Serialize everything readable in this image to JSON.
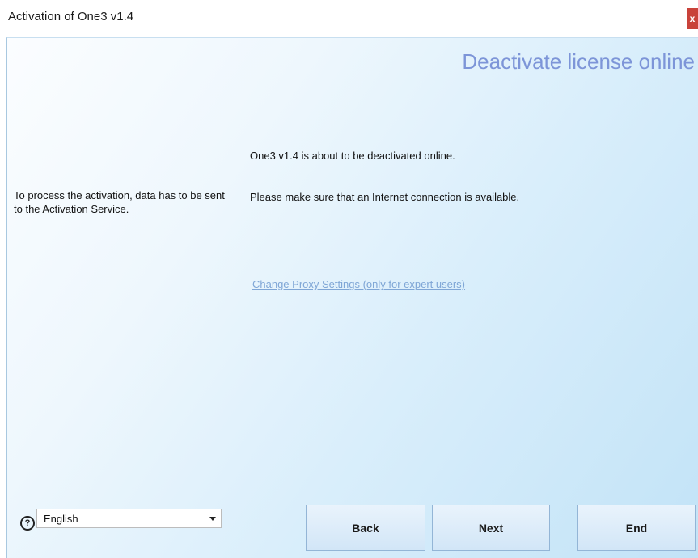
{
  "window": {
    "title": "Activation of One3 v1.4",
    "close_glyph": "x"
  },
  "page": {
    "heading": "Deactivate license online",
    "left_info": "To process the activation, data has to be sent to the Activation Service.",
    "message_1": "One3 v1.4 is about to be deactivated online.",
    "message_2": "Please make sure that an Internet connection is available.",
    "proxy_link": "Change Proxy Settings (only for expert users)"
  },
  "footer": {
    "help_glyph": "?",
    "help_icon": "question-circle-icon",
    "language_selected": "English",
    "buttons": {
      "back": "Back",
      "next": "Next",
      "end": "End"
    }
  },
  "colors": {
    "heading": "#7d95d8",
    "link": "#7fa6d6",
    "close_button": "#c9423a",
    "panel_gradient_start": "#fbfdff",
    "panel_gradient_end": "#c2e3f7"
  }
}
